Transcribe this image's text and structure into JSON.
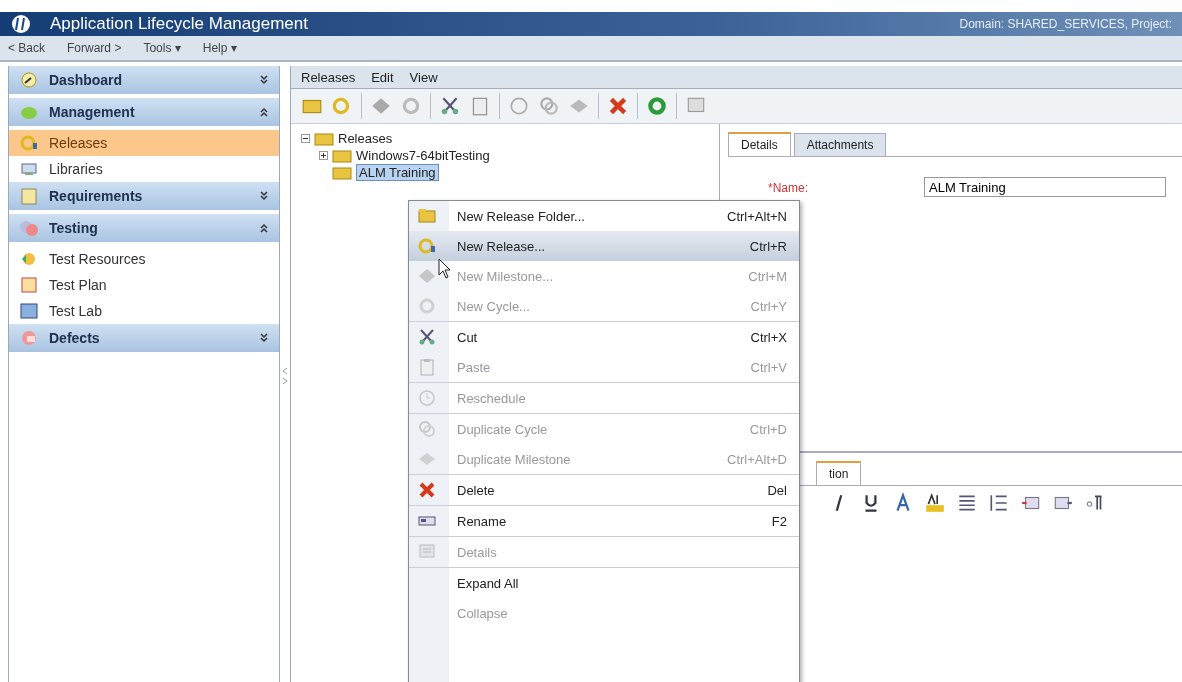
{
  "window": {
    "title": "Application Lifecycle Management",
    "context": "Domain: SHARED_SERVICES, Project:"
  },
  "nav": [
    "< Back",
    "Forward >",
    "Tools ▾",
    "Help ▾"
  ],
  "sidebar": {
    "items": [
      {
        "kind": "header",
        "label": "Dashboard",
        "expanded": false
      },
      {
        "kind": "header",
        "label": "Management",
        "expanded": true
      },
      {
        "kind": "item",
        "label": "Releases",
        "selected": true
      },
      {
        "kind": "item",
        "label": "Libraries",
        "selected": false
      },
      {
        "kind": "header",
        "label": "Requirements",
        "expanded": false
      },
      {
        "kind": "header",
        "label": "Testing",
        "expanded": true
      },
      {
        "kind": "item",
        "label": "Test Resources",
        "selected": false
      },
      {
        "kind": "item",
        "label": "Test Plan",
        "selected": false
      },
      {
        "kind": "item",
        "label": "Test Lab",
        "selected": false
      },
      {
        "kind": "header",
        "label": "Defects",
        "expanded": false
      }
    ]
  },
  "menubar": [
    "Releases",
    "Edit",
    "View"
  ],
  "tree": [
    {
      "label": "Releases",
      "expanded": true,
      "selected": false,
      "children": [
        {
          "label": "Windows7-64bitTesting",
          "expanded": false,
          "selected": false
        },
        {
          "label": "ALM Training",
          "selected": true
        }
      ]
    }
  ],
  "details": {
    "tabs": [
      {
        "label": "Details",
        "selected": true
      },
      {
        "label": "Attachments",
        "selected": false
      }
    ],
    "name_label": "*Name:",
    "name_value": "ALM Training",
    "lower_tabs": [
      {
        "label": "tion",
        "selected": true
      }
    ]
  },
  "context_menu": [
    {
      "label": "New Release Folder...",
      "shortcut": "Ctrl+Alt+N",
      "disabled": false,
      "selected": false,
      "separator": false
    },
    {
      "label": "New Release...",
      "shortcut": "Ctrl+R",
      "disabled": false,
      "selected": true,
      "separator": false
    },
    {
      "label": "New Milestone...",
      "shortcut": "Ctrl+M",
      "disabled": true,
      "selected": false,
      "separator": false
    },
    {
      "label": "New Cycle...",
      "shortcut": "Ctrl+Y",
      "disabled": true,
      "selected": false,
      "separator": false
    },
    {
      "label": "Cut",
      "shortcut": "Ctrl+X",
      "disabled": false,
      "selected": false,
      "separator": true
    },
    {
      "label": "Paste",
      "shortcut": "Ctrl+V",
      "disabled": true,
      "selected": false,
      "separator": false
    },
    {
      "label": "Reschedule",
      "disabled": true,
      "selected": false,
      "separator": true
    },
    {
      "label": "Duplicate Cycle",
      "shortcut": "Ctrl+D",
      "disabled": true,
      "selected": false,
      "separator": true
    },
    {
      "label": "Duplicate Milestone",
      "shortcut": "Ctrl+Alt+D",
      "disabled": true,
      "selected": false,
      "separator": false
    },
    {
      "label": "Delete",
      "shortcut": "Del",
      "disabled": false,
      "selected": false,
      "separator": true
    },
    {
      "label": "Rename",
      "shortcut": "F2",
      "disabled": false,
      "selected": false,
      "separator": true
    },
    {
      "label": "Details",
      "disabled": true,
      "selected": false,
      "separator": true
    },
    {
      "label": "Expand All",
      "disabled": false,
      "selected": false,
      "separator": true
    },
    {
      "label": "Collapse",
      "disabled": true,
      "selected": false,
      "separator": false
    }
  ]
}
